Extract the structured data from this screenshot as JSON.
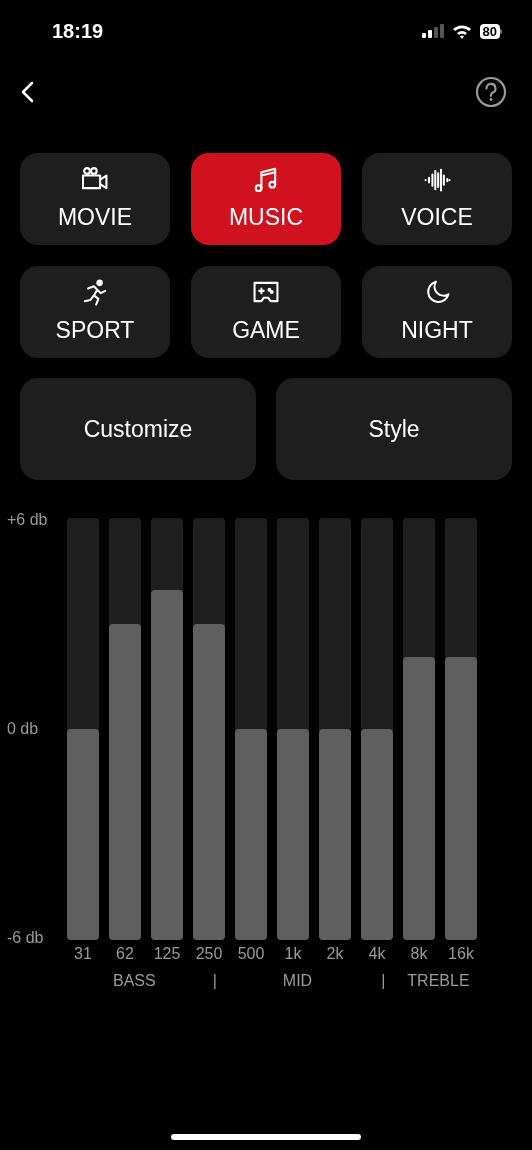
{
  "status_bar": {
    "time": "18:19",
    "battery": "80"
  },
  "modes": [
    {
      "label": "MOVIE",
      "kind": "movie",
      "selected": false
    },
    {
      "label": "MUSIC",
      "kind": "music",
      "selected": true
    },
    {
      "label": "VOICE",
      "kind": "voice",
      "selected": false
    },
    {
      "label": "SPORT",
      "kind": "sport",
      "selected": false
    },
    {
      "label": "GAME",
      "kind": "game",
      "selected": false
    },
    {
      "label": "NIGHT",
      "kind": "night",
      "selected": false
    }
  ],
  "actions": [
    "Customize",
    "Style"
  ],
  "equalizer": {
    "axis_labels": [
      "+6 db",
      "0 db",
      "-6 db"
    ],
    "bands": [
      {
        "label": "31",
        "level": 0.5
      },
      {
        "label": "62",
        "level": 0.75
      },
      {
        "label": "125",
        "level": 0.83
      },
      {
        "label": "250",
        "level": 0.75
      },
      {
        "label": "500",
        "level": 0.5
      },
      {
        "label": "1k",
        "level": 0.5
      },
      {
        "label": "2k",
        "level": 0.5
      },
      {
        "label": "4k",
        "level": 0.5
      },
      {
        "label": "8k",
        "level": 0.67
      },
      {
        "label": "16k",
        "level": 0.67
      }
    ],
    "groups": [
      "BASS",
      "|",
      "MID",
      "|",
      "TREBLE"
    ]
  }
}
